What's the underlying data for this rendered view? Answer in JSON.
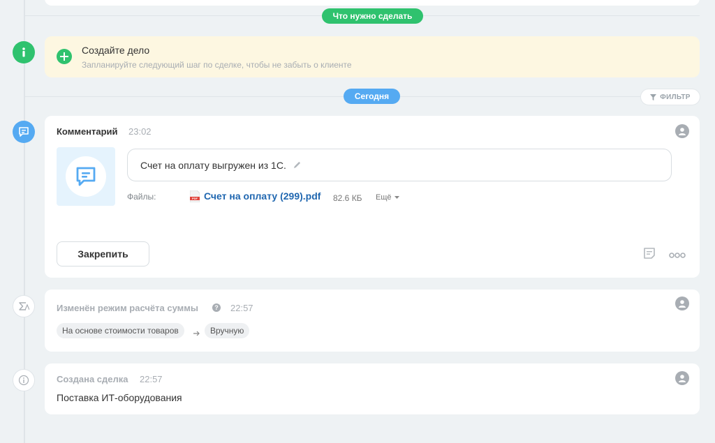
{
  "header": {
    "todo_pill": "Что нужно сделать"
  },
  "todo": {
    "title": "Создайте дело",
    "subtitle": "Запланируйте следующий шаг по сделке, чтобы не забыть о клиенте"
  },
  "today_pill": "Сегодня",
  "filter_label": "ФИЛЬТР",
  "comment": {
    "title": "Комментарий",
    "time": "23:02",
    "text": "Счет на оплату выгружен из 1С.",
    "files_label": "Файлы:",
    "file_name": "Счет на оплату (299).pdf",
    "file_size": "82.6 КБ",
    "more_label": "Ещё",
    "pin_button": "Закрепить"
  },
  "sum_mode": {
    "title": "Изменён режим расчёта суммы",
    "time": "22:57",
    "from": "На основе стоимости товаров",
    "to": "Вручную"
  },
  "deal_created": {
    "title": "Создана сделка",
    "time": "22:57",
    "name": "Поставка ИТ-оборудования"
  },
  "colors": {
    "green": "#2fc26e",
    "blue": "#55aaf2",
    "link": "#2067b0",
    "todo_bg": "#fdf7e1"
  }
}
